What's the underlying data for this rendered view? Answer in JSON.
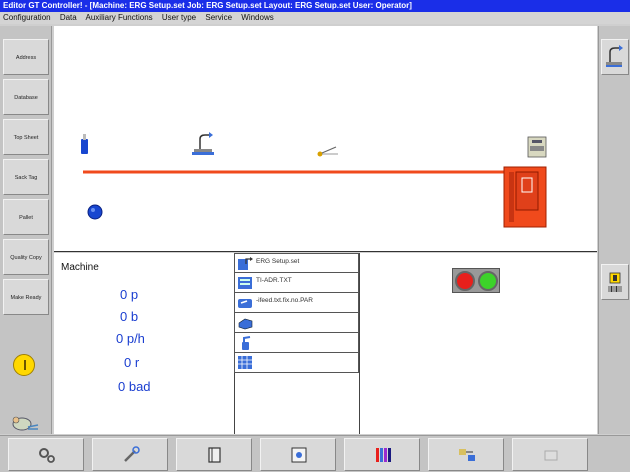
{
  "window": {
    "title": "Editor GT Controller! - [Machine: ERG Setup.set   Job: ERG Setup.set   Layout: ERG Setup.set   User: Operator]"
  },
  "menu": [
    "Configuration",
    "Data",
    "Auxiliary Functions",
    "User type",
    "Service",
    "Windows"
  ],
  "sidebar": {
    "items": [
      {
        "label": "Address"
      },
      {
        "label": "Database"
      },
      {
        "label": "Top Sheet"
      },
      {
        "label": "Sack Tag"
      },
      {
        "label": "Pallet"
      },
      {
        "label": "Quality Copy"
      },
      {
        "label": "Make Ready"
      }
    ],
    "warning_icon": "exclamation-icon"
  },
  "rightbar": {
    "items": [
      {
        "icon": "feeder-icon"
      },
      {
        "icon": "barcode-scanner-icon"
      }
    ]
  },
  "machine": {
    "label": "Machine",
    "stats": [
      "0 p",
      "0 b",
      "0 p/h",
      "0 r",
      "0 bad"
    ]
  },
  "files": [
    {
      "icon": "setup-icon",
      "text": "ERG Setup.set"
    },
    {
      "icon": "document-icon",
      "text": "TI-ADR.TXT"
    },
    {
      "icon": "feeder-small-icon",
      "text": "-ifeed.txt.fix.no.PAR"
    },
    {
      "icon": "stack-icon",
      "text": ""
    },
    {
      "icon": "sprayer-icon",
      "text": ""
    },
    {
      "icon": "grid-icon",
      "text": ""
    }
  ],
  "signals": {
    "stop_color": "#e8201c",
    "start_color": "#3dd22a"
  },
  "colors": {
    "title_bar": "#1a2ee8",
    "conveyor": "#f04a1c",
    "stat_text": "#1a3ed0"
  },
  "bottombar": {
    "buttons": [
      {
        "icon": "gears-icon"
      },
      {
        "icon": "tools-icon"
      },
      {
        "icon": "book-icon"
      },
      {
        "icon": "preview-icon"
      },
      {
        "icon": "color-bars-icon"
      },
      {
        "icon": "transfer-icon"
      },
      {
        "icon": "disabled-icon"
      }
    ]
  }
}
